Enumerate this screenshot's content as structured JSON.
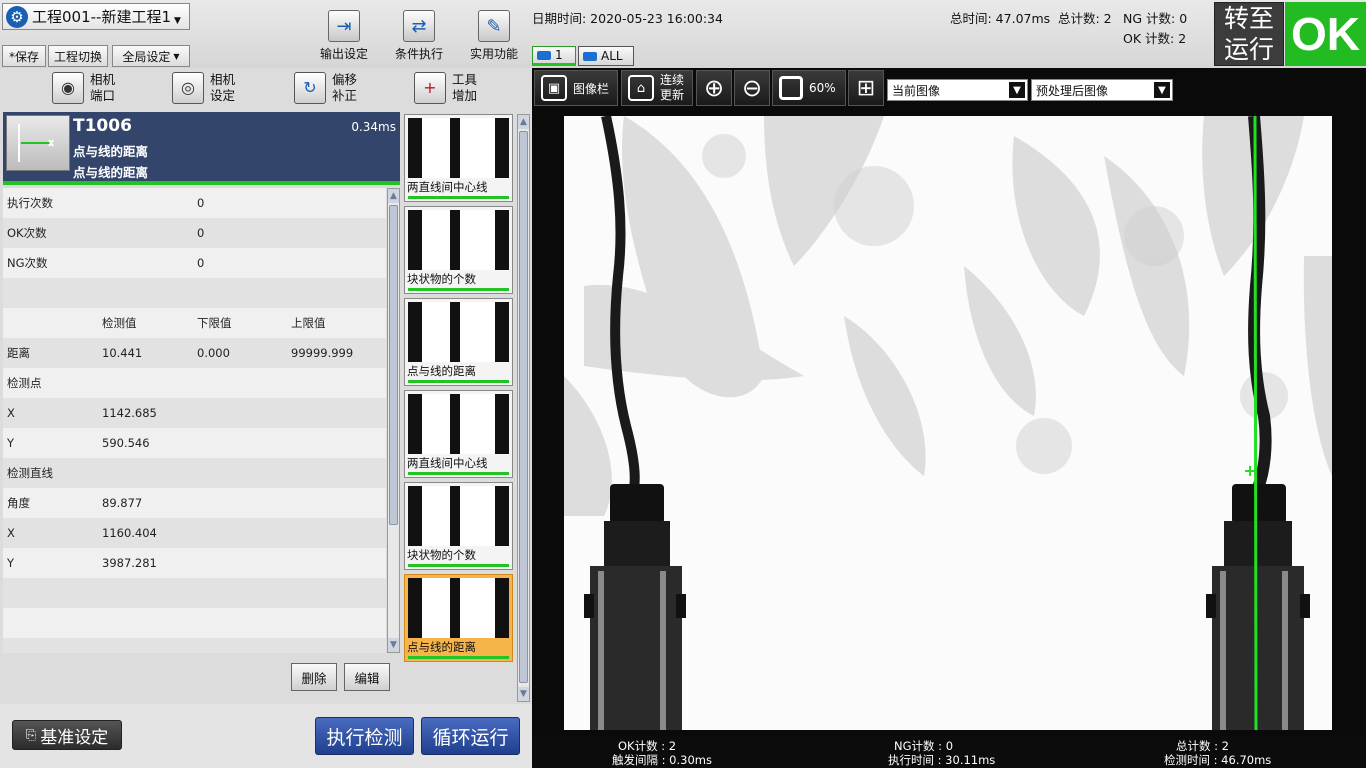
{
  "top": {
    "project_title": "工程001--新建工程1",
    "save_label": "*保存",
    "switch_label": "工程切换",
    "global_label": "全局设定",
    "output_label": "输出设定",
    "condition_label": "条件执行",
    "utility_label": "实用功能",
    "datetime": "日期时间: 2020-05-23 16:00:34",
    "total_time": "总时间: 47.07ms",
    "total_count": "总计数: 2",
    "ng_count": "NG 计数: 0",
    "ok_count": "OK 计数: 2",
    "run_label_1": "转至",
    "run_label_2": "运行",
    "result": "OK",
    "cam_tab_1": "1",
    "cam_tab_all": "ALL"
  },
  "left": {
    "tools": [
      {
        "l1": "相机",
        "l2": "端口"
      },
      {
        "l1": "相机",
        "l2": "设定"
      },
      {
        "l1": "偏移",
        "l2": "补正"
      },
      {
        "l1": "工具",
        "l2": "增加"
      }
    ],
    "tool_id": "T1006",
    "tool_time": "0.34ms",
    "tool_name": "点与线的距离",
    "tool_desc": "点与线的距离",
    "rows": {
      "exec_count_label": "执行次数",
      "exec_count_value": "0",
      "ok_count_label": "OK次数",
      "ok_count_value": "0",
      "ng_count_label": "NG次数",
      "ng_count_value": "0",
      "col_detect": "检测值",
      "col_lower": "下限值",
      "col_upper": "上限值",
      "distance_label": "距离",
      "distance_value": "10.441",
      "distance_lower": "0.000",
      "distance_upper": "99999.999",
      "point_label": "检测点",
      "px_label": "X",
      "px_value": "1142.685",
      "py_label": "Y",
      "py_value": "590.546",
      "line_label": "检测直线",
      "angle_label": "角度",
      "angle_value": "89.877",
      "lx_label": "X",
      "lx_value": "1160.404",
      "ly_label": "Y",
      "ly_value": "3987.281"
    },
    "delete_label": "删除",
    "edit_label": "编辑",
    "thumbs": [
      "两直线间中心线",
      "块状物的个数",
      "点与线的距离",
      "两直线间中心线",
      "块状物的个数",
      "点与线的距离"
    ],
    "baseline_label": "基准设定",
    "execute_label": "执行检测",
    "loop_label": "循环运行"
  },
  "right": {
    "imagebar_label": "图像栏",
    "continuous_l1": "连续",
    "continuous_l2": "更新",
    "zoom": "60%",
    "current_image": "当前图像",
    "processed_image": "预处理后图像",
    "stats": {
      "ok": "OK计数 : 2",
      "trigger": "触发间隔 : 0.30ms",
      "ng": "NG计数 : 0",
      "exec": "执行时间 : 30.11ms",
      "total": "总计数 : 2",
      "detect": "检测时间 : 46.70ms"
    }
  },
  "colors": {
    "ok_green": "#22bb22",
    "header_blue": "#33456a",
    "button_blue": "#1f3f8e",
    "selected_orange": "#f6b54a"
  }
}
